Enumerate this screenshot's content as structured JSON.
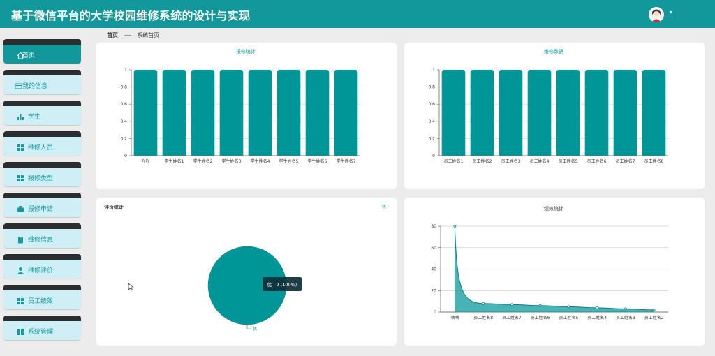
{
  "app": {
    "title": "基于微信平台的大学校园维修系统的设计与实现"
  },
  "header": {
    "avatar_icon": "avatar-icon",
    "caret": "▾"
  },
  "sidebar": {
    "items": [
      {
        "label": "首页",
        "icon": "home-icon",
        "active": true
      },
      {
        "label": "我的信息",
        "icon": "card-icon"
      },
      {
        "label": "学生",
        "icon": "bar-chart-icon"
      },
      {
        "label": "维修人员",
        "icon": "grid-icon"
      },
      {
        "label": "报修类型",
        "icon": "grid-icon"
      },
      {
        "label": "报修申请",
        "icon": "briefcase-icon"
      },
      {
        "label": "维修信息",
        "icon": "clipboard-icon"
      },
      {
        "label": "维修评价",
        "icon": "user-icon"
      },
      {
        "label": "员工绩效",
        "icon": "grid-icon"
      },
      {
        "label": "系统管理",
        "icon": "grid-icon"
      }
    ]
  },
  "breadcrumb": {
    "home": "首页",
    "current": "系统首页"
  },
  "cards": {
    "repair_stats": {
      "title": "报修统计"
    },
    "maintenance_data": {
      "title": "维修数据"
    },
    "evaluation_stats": {
      "title": "评价统计",
      "filter": "优 ◦"
    },
    "performance_stats": {
      "title": "绩效统计"
    }
  },
  "colors": {
    "teal": "#12989b",
    "bar": "#009597",
    "nav_bg": "#cfeef5",
    "dark_strip": "#2b2d31"
  },
  "chart_data": [
    {
      "type": "bar",
      "title": "报修统计",
      "categories": [
        "吖吖",
        "学生姓名1",
        "学生姓名2",
        "学生姓名3",
        "学生姓名4",
        "学生姓名5",
        "学生姓名6",
        "学生姓名7"
      ],
      "values": [
        1,
        1,
        1,
        1,
        1,
        1,
        1,
        1
      ],
      "yticks": [
        "0",
        "0.2",
        "0.4",
        "0.6",
        "0.8",
        "1"
      ],
      "ylim": [
        0,
        1
      ]
    },
    {
      "type": "bar",
      "title": "维修数据",
      "categories": [
        "员工姓名1",
        "员工姓名2",
        "员工姓名3",
        "员工姓名4",
        "员工姓名5",
        "员工姓名6",
        "员工姓名7",
        "员工姓名8"
      ],
      "values": [
        1,
        1,
        1,
        1,
        1,
        1,
        1,
        1
      ],
      "yticks": [
        "0",
        "0.2",
        "0.4",
        "0.6",
        "0.8",
        "1"
      ],
      "ylim": [
        0,
        1
      ]
    },
    {
      "type": "pie",
      "title": "评价统计",
      "slices": [
        {
          "label": "优",
          "value": 9,
          "percent": 100
        }
      ],
      "tooltip": "优 : 9 (100%)"
    },
    {
      "type": "area",
      "title": "绩效统计",
      "categories": [
        "嘀嘀",
        "员工姓名8",
        "员工姓名7",
        "员工姓名6",
        "员工姓名5",
        "员工姓名4",
        "员工姓名3",
        "员工姓名2"
      ],
      "values": [
        80,
        8,
        7,
        6,
        5,
        4,
        3,
        2
      ],
      "yticks": [
        "0",
        "20",
        "40",
        "60",
        "80"
      ],
      "ylim": [
        0,
        80
      ]
    }
  ]
}
